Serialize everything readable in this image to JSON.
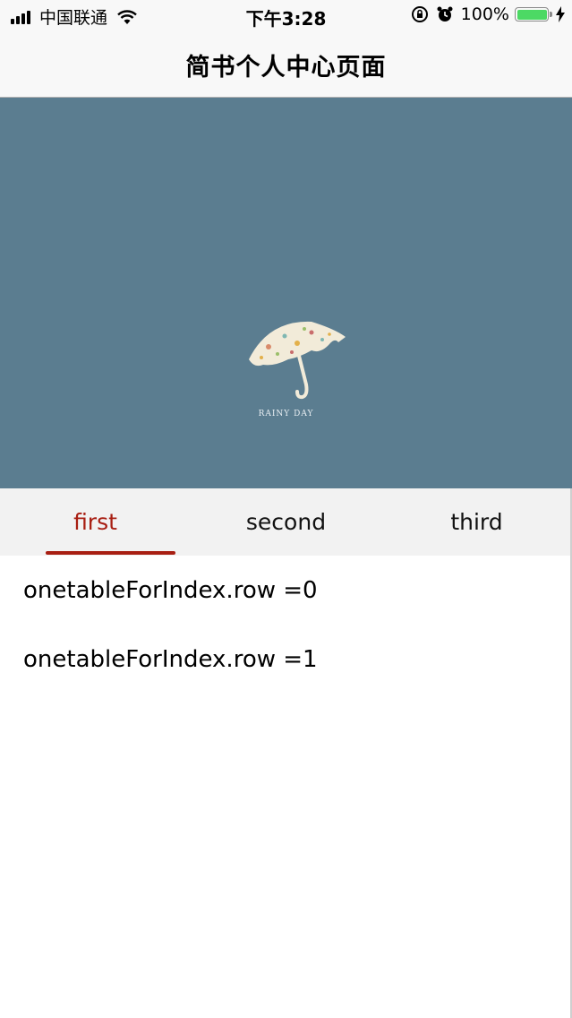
{
  "status_bar": {
    "carrier": "中国联通",
    "time": "下午3:28",
    "battery_percent": "100%",
    "battery_level": 1.0,
    "icons": [
      "signal-icon",
      "wifi-icon",
      "rotation-lock-icon",
      "alarm-icon",
      "battery-icon",
      "charging-icon"
    ]
  },
  "nav": {
    "title": "简书个人中心页面"
  },
  "header": {
    "image_caption": "RAINY DAY",
    "background_color": "#5b7d90"
  },
  "tabs": [
    {
      "label": "first",
      "active": true
    },
    {
      "label": "second",
      "active": false
    },
    {
      "label": "third",
      "active": false
    }
  ],
  "accent_color": "#a81e12",
  "list": [
    {
      "label": "onetableForIndex.row =0"
    },
    {
      "label": "onetableForIndex.row =1"
    }
  ]
}
